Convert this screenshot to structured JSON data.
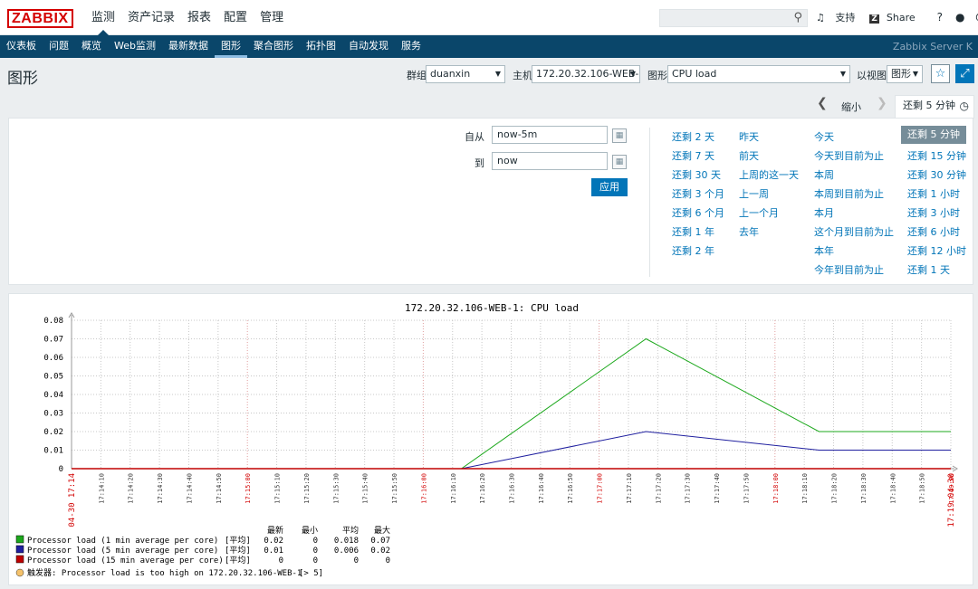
{
  "logo": "ZABBIX",
  "top_menu": [
    "监测",
    "资产记录",
    "报表",
    "配置",
    "管理"
  ],
  "search_icon": "search-icon",
  "top_links": {
    "support": "支持",
    "share": "Share",
    "help": "?"
  },
  "sub_menu": [
    "仪表板",
    "问题",
    "概览",
    "Web监测",
    "最新数据",
    "图形",
    "聚合图形",
    "拓扑图",
    "自动发现",
    "服务"
  ],
  "server_name": "Zabbix Server K",
  "page_title": "图形",
  "filters": {
    "group_label": "群组",
    "group_value": "duanxin",
    "host_label": "主机",
    "host_value": "172.20.32.106-WEB-1",
    "graph_label": "图形",
    "graph_value": "CPU load",
    "view_label": "以视图",
    "view_value": "图形"
  },
  "timebar": {
    "zoom_out": "缩小",
    "tab_label": "还剩 5 分钟"
  },
  "time_filter": {
    "from_label": "自从",
    "from_value": "now-5m",
    "to_label": "到",
    "to_value": "now",
    "apply": "应用"
  },
  "quick_ranges": [
    [
      "还剩 2 天",
      "还剩 7 天",
      "还剩 30 天",
      "还剩 3 个月",
      "还剩 6 个月",
      "还剩 1 年",
      "还剩 2 年"
    ],
    [
      "昨天",
      "前天",
      "上周的这一天",
      "上一周",
      "上一个月",
      "去年"
    ],
    [
      "今天",
      "今天到目前为止",
      "本周",
      "本周到目前为止",
      "本月",
      "这个月到目前为止",
      "本年",
      "今年到目前为止"
    ],
    [
      "还剩 5 分钟",
      "还剩 15 分钟",
      "还剩 30 分钟",
      "还剩 1 小时",
      "还剩 3 小时",
      "还剩 6 小时",
      "还剩 12 小时",
      "还剩 1 天"
    ]
  ],
  "chart_data": {
    "type": "line",
    "title": "172.20.32.106-WEB-1: CPU load",
    "x": [
      "17:14",
      "17:14:10",
      "17:14:20",
      "17:14:30",
      "17:14:40",
      "17:14:50",
      "17:15:00",
      "17:15:10",
      "17:15:20",
      "17:15:30",
      "17:15:40",
      "17:15:50",
      "17:16:00",
      "17:16:10",
      "17:16:20",
      "17:16:30",
      "17:16:40",
      "17:16:50",
      "17:17:00",
      "17:17:10",
      "17:17:20",
      "17:17:30",
      "17:17:40",
      "17:17:50",
      "17:18:00",
      "17:18:10",
      "17:18:20",
      "17:18:30",
      "17:18:40",
      "17:18:50",
      "17:19:00",
      "17:19"
    ],
    "x_edge_date": "04-30",
    "x_major": [
      "17:15:00",
      "17:16:00",
      "17:17:00",
      "17:18:00",
      "17:19:00"
    ],
    "y_ticks": [
      "0",
      "0.01",
      "0.02",
      "0.03",
      "0.04",
      "0.05",
      "0.06",
      "0.07",
      "0.08"
    ],
    "ylim": [
      0,
      0.08
    ],
    "series": [
      {
        "name": "Processor load (1 min average per core)",
        "color": "#1ca81c",
        "points": [
          [
            "17:14",
            0
          ],
          [
            "17:16:13",
            0
          ],
          [
            "17:17:16",
            0.07
          ],
          [
            "17:18:15",
            0.02
          ],
          [
            "17:19",
            0.02
          ]
        ]
      },
      {
        "name": "Processor load (5 min average per core)",
        "color": "#1f1f9f",
        "points": [
          [
            "17:14",
            0
          ],
          [
            "17:16:13",
            0
          ],
          [
            "17:17:16",
            0.02
          ],
          [
            "17:18:15",
            0.01
          ],
          [
            "17:19",
            0.01
          ]
        ]
      },
      {
        "name": "Processor load (15 min average per core)",
        "color": "#c00000",
        "points": [
          [
            "17:14",
            0
          ],
          [
            "17:19",
            0
          ]
        ]
      }
    ],
    "legend": {
      "headers": [
        "最新",
        "最小",
        "平均",
        "最大"
      ],
      "func": "[平均]",
      "rows": [
        {
          "latest": "0.02",
          "min": "0",
          "avg": "0.018",
          "max": "0.07"
        },
        {
          "latest": "0.01",
          "min": "0",
          "avg": "0.006",
          "max": "0.02"
        },
        {
          "latest": "0",
          "min": "0",
          "avg": "0",
          "max": "0"
        }
      ]
    },
    "trigger": {
      "label": "触发器: Processor load is too high on 172.20.32.106-WEB-1",
      "value": "[> 5]",
      "color": "#f5c26b"
    }
  }
}
